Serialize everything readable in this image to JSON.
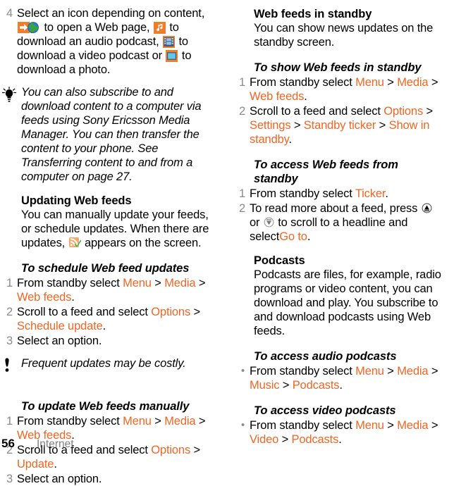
{
  "footer": {
    "page_number": "56",
    "chapter": "Internet"
  },
  "colors": {
    "menu_orange": "#f26522",
    "step_number_gray": "#8b8b8b",
    "chapter_gray": "#808080"
  },
  "left_column": {
    "step4": {
      "number": "4",
      "t1": "Select an icon depending on content,",
      "icon_web": "web-page-icon",
      "t2": "to open a Web page,",
      "icon_audio": "music-note-icon",
      "t3": "to download an audio podcast,",
      "icon_video": "film-strip-icon",
      "t4": "to download a video podcast or",
      "icon_photo": "photo-icon",
      "t5": "to download a photo."
    },
    "tip": {
      "icon": "lightbulb-tip-icon",
      "text": "You can also subscribe to and download content to a computer via feeds using Sony Ericsson Media Manager. You can then transfer the content to your phone. See Transferring content to and from a computer on page 27."
    },
    "updating": {
      "heading": "Updating Web feeds",
      "p1": "You can manually update your feeds, or schedule updates. When there are updates,",
      "icon_feed": "rss-feed-update-icon",
      "p2": "appears on the screen."
    },
    "schedule": {
      "heading": "To schedule Web feed updates",
      "steps": [
        {
          "number": "1",
          "parts": [
            {
              "type": "plain",
              "text": "From standby select "
            },
            {
              "type": "menu",
              "text": "Menu"
            },
            {
              "type": "sep",
              "text": " > "
            },
            {
              "type": "menu",
              "text": "Media"
            },
            {
              "type": "sep",
              "text": " > "
            },
            {
              "type": "menu",
              "text": "Web feeds"
            },
            {
              "type": "plain",
              "text": "."
            }
          ]
        },
        {
          "number": "2",
          "parts": [
            {
              "type": "plain",
              "text": "Scroll to a feed and select "
            },
            {
              "type": "menu",
              "text": "Options"
            },
            {
              "type": "sep",
              "text": " > "
            },
            {
              "type": "menu",
              "text": "Schedule update"
            },
            {
              "type": "plain",
              "text": "."
            }
          ]
        },
        {
          "number": "3",
          "parts": [
            {
              "type": "plain",
              "text": "Select an option."
            }
          ]
        }
      ]
    },
    "note": {
      "icon": "exclamation-note-icon",
      "text": "Frequent updates may be costly."
    },
    "manual": {
      "heading": "To update Web feeds manually",
      "steps": [
        {
          "number": "1",
          "parts": [
            {
              "type": "plain",
              "text": "From standby select "
            },
            {
              "type": "menu",
              "text": "Menu"
            },
            {
              "type": "sep",
              "text": " > "
            },
            {
              "type": "menu",
              "text": "Media"
            },
            {
              "type": "sep",
              "text": " > "
            },
            {
              "type": "menu",
              "text": "Web feeds"
            },
            {
              "type": "plain",
              "text": "."
            }
          ]
        },
        {
          "number": "2",
          "parts": [
            {
              "type": "plain",
              "text": "Scroll to a feed and select "
            },
            {
              "type": "menu",
              "text": "Options"
            },
            {
              "type": "sep",
              "text": " > "
            },
            {
              "type": "menu",
              "text": "Update"
            },
            {
              "type": "plain",
              "text": "."
            }
          ]
        },
        {
          "number": "3",
          "parts": [
            {
              "type": "plain",
              "text": "Select an option."
            }
          ]
        }
      ]
    }
  },
  "right_column": {
    "standby": {
      "heading": "Web feeds in standby",
      "paragraph": "You can show news updates on the standby screen."
    },
    "show": {
      "heading": "To show Web feeds in standby",
      "steps": [
        {
          "number": "1",
          "parts": [
            {
              "type": "plain",
              "text": "From standby select "
            },
            {
              "type": "menu",
              "text": "Menu"
            },
            {
              "type": "sep",
              "text": " > "
            },
            {
              "type": "menu",
              "text": "Media"
            },
            {
              "type": "sep",
              "text": " > "
            },
            {
              "type": "menu",
              "text": "Web feeds"
            },
            {
              "type": "plain",
              "text": "."
            }
          ]
        },
        {
          "number": "2",
          "parts": [
            {
              "type": "plain",
              "text": "Scroll to a feed and select "
            },
            {
              "type": "menu",
              "text": "Options"
            },
            {
              "type": "sep",
              "text": " > "
            },
            {
              "type": "menu",
              "text": "Settings"
            },
            {
              "type": "sep",
              "text": " > "
            },
            {
              "type": "menu",
              "text": "Standby ticker"
            },
            {
              "type": "sep",
              "text": " > "
            },
            {
              "type": "menu",
              "text": "Show in standby"
            },
            {
              "type": "plain",
              "text": "."
            }
          ]
        }
      ]
    },
    "access": {
      "heading": "To access Web feeds from standby",
      "step1": {
        "number": "1",
        "parts": [
          {
            "type": "plain",
            "text": "From standby select "
          },
          {
            "type": "menu",
            "text": "Ticker"
          },
          {
            "type": "plain",
            "text": "."
          }
        ]
      },
      "step2": {
        "number": "2",
        "t1": "To read more about a feed, press",
        "icon_up": "nav-key-up-icon",
        "t2": "or",
        "icon_down": "nav-key-down-icon",
        "t3": "to scroll to a headline and select",
        "menu": "Go to",
        "t4": "."
      }
    },
    "podcasts": {
      "heading": "Podcasts",
      "paragraph": "Podcasts are files, for example, radio programs or video content, you can download and play. You subscribe to and download podcasts using Web feeds."
    },
    "audio": {
      "heading": "To access audio podcasts",
      "bullet": "•",
      "parts": [
        {
          "type": "plain",
          "text": "From standby select "
        },
        {
          "type": "menu",
          "text": "Menu"
        },
        {
          "type": "sep",
          "text": " > "
        },
        {
          "type": "menu",
          "text": "Media"
        },
        {
          "type": "sep",
          "text": " > "
        },
        {
          "type": "menu",
          "text": "Music"
        },
        {
          "type": "sep",
          "text": " > "
        },
        {
          "type": "menu",
          "text": "Podcasts"
        },
        {
          "type": "plain",
          "text": "."
        }
      ]
    },
    "video": {
      "heading": "To access video podcasts",
      "bullet": "•",
      "parts": [
        {
          "type": "plain",
          "text": "From standby select "
        },
        {
          "type": "menu",
          "text": "Menu"
        },
        {
          "type": "sep",
          "text": " > "
        },
        {
          "type": "menu",
          "text": "Media"
        },
        {
          "type": "sep",
          "text": " > "
        },
        {
          "type": "menu",
          "text": "Video"
        },
        {
          "type": "sep",
          "text": " > "
        },
        {
          "type": "menu",
          "text": "Podcasts"
        },
        {
          "type": "plain",
          "text": "."
        }
      ]
    }
  }
}
